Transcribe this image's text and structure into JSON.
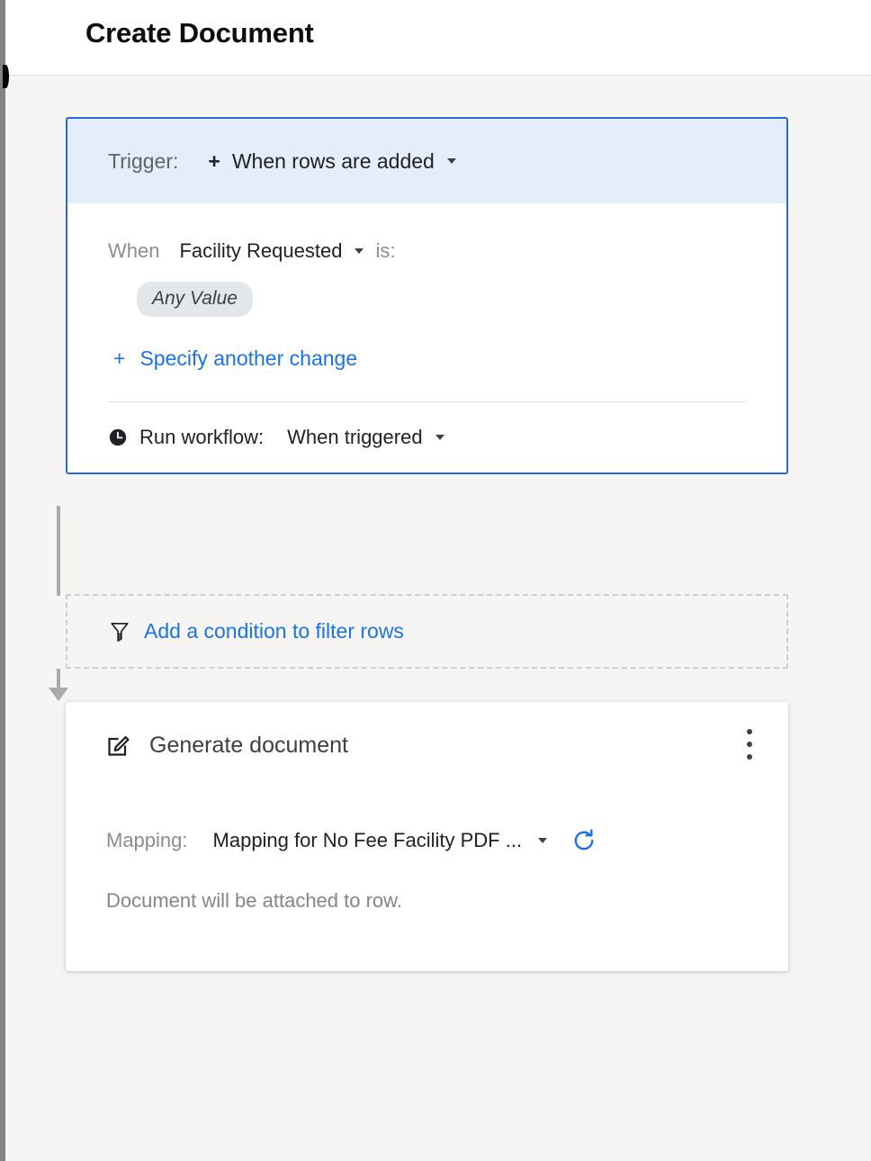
{
  "header": {
    "title": "Create Document"
  },
  "trigger": {
    "label": "Trigger:",
    "plus_icon": "plus-icon",
    "value": "When rows are added",
    "caret_icon": "chevron-down-icon",
    "when_label": "When",
    "when_field": "Facility Requested",
    "when_field_caret": "chevron-down-icon",
    "is_label": "is:",
    "chip": "Any Value",
    "specify_plus": "+",
    "specify_link": "Specify another change",
    "run_icon": "clock-icon",
    "run_label": "Run workflow:",
    "run_value": "When triggered",
    "run_caret": "chevron-down-icon"
  },
  "condition": {
    "icon": "filter-funnel-icon",
    "link": "Add a condition to filter rows"
  },
  "generate": {
    "icon": "edit-document-icon",
    "title": "Generate document",
    "menu_icon": "kebab-menu-icon",
    "mapping_label": "Mapping:",
    "mapping_value": "Mapping for No Fee Facility PDF ...",
    "mapping_caret": "chevron-down-icon",
    "refresh_icon": "refresh-icon",
    "note": "Document will be attached to row."
  },
  "colors": {
    "accent_blue": "#1a73e8",
    "trigger_border": "#276ae0",
    "trigger_header_bg": "#e4edfa",
    "canvas_bg": "#f6f5f3",
    "chip_bg": "#e3e7ea",
    "connector": "#a8abac"
  }
}
